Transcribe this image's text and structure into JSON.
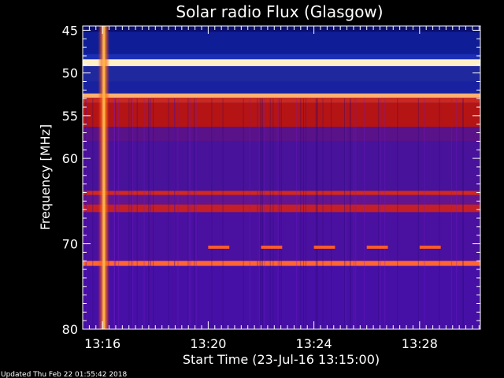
{
  "chart_data": {
    "type": "heatmap",
    "title": "Solar radio Flux (Glasgow)",
    "xlabel": "Start Time (23-Jul-16 13:15:00)",
    "ylabel": "Frequency [MHz]",
    "x_unit": "minutes after 13:15:00",
    "xlim": [
      0.25,
      15.3
    ],
    "ylim": [
      80,
      44.5
    ],
    "y_ticks": [
      {
        "label": "45",
        "value": 45
      },
      {
        "label": "50",
        "value": 50
      },
      {
        "label": "55",
        "value": 55
      },
      {
        "label": "60",
        "value": 60
      },
      {
        "label": "70",
        "value": 70
      },
      {
        "label": "80",
        "value": 80
      }
    ],
    "x_ticks": [
      {
        "label": "13:16",
        "value": 1
      },
      {
        "label": "13:20",
        "value": 5
      },
      {
        "label": "13:24",
        "value": 9
      },
      {
        "label": "13:28",
        "value": 13
      }
    ],
    "y_minor_step": 1,
    "x_minor_step": 0.25,
    "colormap": "heat",
    "background_color": "#3A0DA0",
    "frequency_bands": [
      {
        "f0": 44.5,
        "f1": 45.2,
        "level": 0.1,
        "color": "#0A0E6E"
      },
      {
        "f0": 45.2,
        "f1": 47.8,
        "level": 0.15,
        "color": "#0F1E96"
      },
      {
        "f0": 47.8,
        "f1": 48.4,
        "level": 0.3,
        "color": "#1C2FB4"
      },
      {
        "f0": 48.4,
        "f1": 49.2,
        "level": 1.0,
        "color": "#FFF0C8"
      },
      {
        "f0": 49.2,
        "f1": 51.0,
        "level": 0.25,
        "color": "#20289E"
      },
      {
        "f0": 51.0,
        "f1": 52.4,
        "level": 0.2,
        "color": "#1822A0"
      },
      {
        "f0": 52.4,
        "f1": 52.9,
        "level": 0.9,
        "color": "#FFB070"
      },
      {
        "f0": 52.9,
        "f1": 53.5,
        "level": 0.6,
        "color": "#C8281E"
      },
      {
        "f0": 53.5,
        "f1": 56.3,
        "level": 0.55,
        "color": "#B41414"
      },
      {
        "f0": 56.3,
        "f1": 58.0,
        "level": 0.3,
        "color": "#5A1288"
      },
      {
        "f0": 58.0,
        "f1": 63.8,
        "level": 0.25,
        "color": "#48129A"
      },
      {
        "f0": 63.8,
        "f1": 64.3,
        "level": 0.7,
        "color": "#D2281E"
      },
      {
        "f0": 64.3,
        "f1": 65.4,
        "level": 0.35,
        "color": "#64148C"
      },
      {
        "f0": 65.4,
        "f1": 66.3,
        "level": 0.65,
        "color": "#C41E28"
      },
      {
        "f0": 66.3,
        "f1": 72.0,
        "level": 0.25,
        "color": "#4A10A0"
      },
      {
        "f0": 72.0,
        "f1": 72.6,
        "level": 0.85,
        "color": "#FF6432"
      },
      {
        "f0": 72.6,
        "f1": 80.0,
        "level": 0.25,
        "color": "#4610A6"
      }
    ],
    "burst": {
      "time_center": 1.05,
      "width_min": 0.22,
      "level": 1.0,
      "color": "#FFB43C"
    },
    "interference_blips": [
      {
        "t0": 5.0,
        "t1": 5.8,
        "freq": 70.4
      },
      {
        "t0": 7.0,
        "t1": 7.8,
        "freq": 70.4
      },
      {
        "t0": 9.0,
        "t1": 9.8,
        "freq": 70.4
      },
      {
        "t0": 11.0,
        "t1": 11.8,
        "freq": 70.4
      },
      {
        "t0": 13.0,
        "t1": 13.8,
        "freq": 70.4
      }
    ]
  },
  "footer": {
    "updated": "Updated Thu Feb 22 01:55:42 2018"
  }
}
